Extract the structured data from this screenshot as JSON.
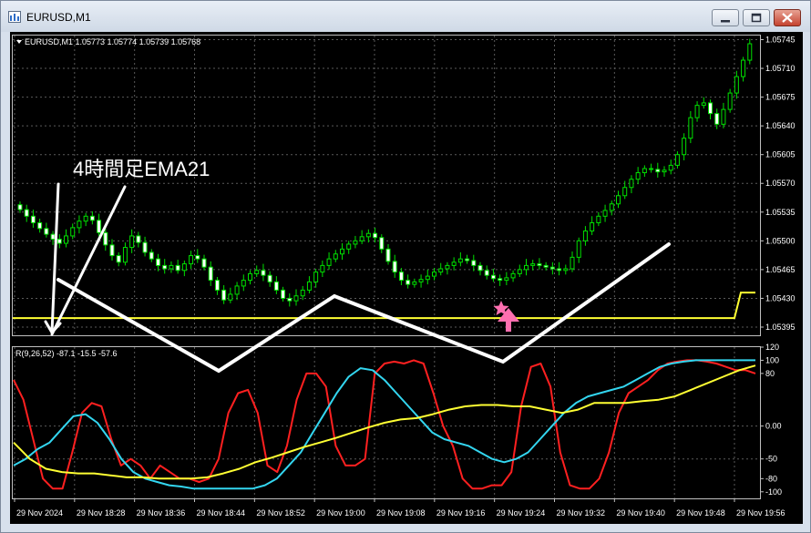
{
  "window": {
    "title": "EURUSD,M1",
    "buttons": [
      "minimize",
      "restore",
      "close"
    ]
  },
  "chart_data": [
    {
      "type": "candlestick",
      "header": "EURUSD,M1  1.05773 1.05774 1.05739 1.05768",
      "annotation": "4時間足EMA21",
      "y_ticks": [
        "1.05745",
        "1.05710",
        "1.05675",
        "1.05640",
        "1.05605",
        "1.05570",
        "1.05535",
        "1.05500",
        "1.05465",
        "1.05430",
        "1.05395"
      ],
      "ylim": [
        1.05385,
        1.0575
      ],
      "x_ticks": [
        "29 Nov 2024",
        "29 Nov 18:28",
        "29 Nov 18:36",
        "29 Nov 18:44",
        "29 Nov 18:52",
        "29 Nov 19:00",
        "29 Nov 19:08",
        "29 Nov 19:16",
        "29 Nov 19:24",
        "29 Nov 19:32",
        "29 Nov 19:40",
        "29 Nov 19:48",
        "29 Nov 19:56"
      ],
      "ema_level": {
        "price": 1.05406,
        "jump_to": 1.05437,
        "color": "#ffff33"
      },
      "signal_icons": [
        "pink-star",
        "pink-up-arrow"
      ],
      "close_values": [
        1.05538,
        1.0553,
        1.05522,
        1.05515,
        1.05508,
        1.05502,
        1.05497,
        1.05506,
        1.05516,
        1.05524,
        1.0553,
        1.05525,
        1.0551,
        1.05495,
        1.05482,
        1.05474,
        1.05492,
        1.05506,
        1.05498,
        1.05486,
        1.05478,
        1.0547,
        1.05466,
        1.0547,
        1.05464,
        1.05472,
        1.05482,
        1.05478,
        1.05468,
        1.05452,
        1.0544,
        1.05428,
        1.05435,
        1.05445,
        1.05452,
        1.0546,
        1.05464,
        1.05458,
        1.0545,
        1.0544,
        1.0543,
        1.05427,
        1.05433,
        1.0544,
        1.0545,
        1.05462,
        1.0547,
        1.05478,
        1.05484,
        1.0549,
        1.05496,
        1.055,
        1.05505,
        1.05509,
        1.05504,
        1.0549,
        1.05475,
        1.05462,
        1.05452,
        1.05447,
        1.0545,
        1.05453,
        1.05457,
        1.05462,
        1.05466,
        1.0547,
        1.05474,
        1.05478,
        1.05476,
        1.0547,
        1.05464,
        1.05458,
        1.05454,
        1.05452,
        1.05455,
        1.0546,
        1.05465,
        1.0547,
        1.05472,
        1.0547,
        1.05468,
        1.05466,
        1.05464,
        1.05466,
        1.0548,
        1.055,
        1.05512,
        1.05522,
        1.0553,
        1.05537,
        1.05545,
        1.05555,
        1.05565,
        1.05575,
        1.05583,
        1.05588,
        1.05587,
        1.05584,
        1.05586,
        1.05592,
        1.05605,
        1.05625,
        1.0565,
        1.05665,
        1.05668,
        1.05655,
        1.05642,
        1.0566,
        1.0568,
        1.057,
        1.0572,
        1.0574
      ]
    },
    {
      "type": "line",
      "header": "R(9,26,52) -87.1 -15.5 -57.6",
      "y_ticks": [
        "120",
        "100",
        "80",
        "0.00",
        "-50",
        "-80",
        "-100"
      ],
      "ylim": [
        -110,
        120
      ],
      "series": [
        {
          "color": "#ff2020",
          "values": [
            70,
            40,
            -20,
            -80,
            -95,
            -95,
            -40,
            20,
            35,
            30,
            -20,
            -60,
            -50,
            -60,
            -80,
            -60,
            -70,
            -80,
            -80,
            -85,
            -80,
            -50,
            20,
            50,
            55,
            20,
            -60,
            -70,
            -30,
            40,
            80,
            80,
            60,
            -30,
            -60,
            -60,
            -50,
            80,
            95,
            98,
            95,
            100,
            95,
            50,
            0,
            -30,
            -80,
            -95,
            -95,
            -90,
            -90,
            -70,
            30,
            90,
            95,
            60,
            -40,
            -90,
            -95,
            -95,
            -80,
            -40,
            20,
            50,
            60,
            70,
            85,
            95,
            98,
            100,
            100,
            98,
            95,
            90,
            85,
            85,
            80
          ]
        },
        {
          "color": "#33d6f0",
          "values": [
            -60,
            -50,
            -35,
            -25,
            -5,
            15,
            18,
            5,
            -20,
            -50,
            -70,
            -80,
            -85,
            -90,
            -92,
            -95,
            -95,
            -95,
            -95,
            -95,
            -95,
            -90,
            -80,
            -60,
            -40,
            -10,
            20,
            50,
            75,
            88,
            85,
            70,
            50,
            30,
            10,
            -10,
            -20,
            -25,
            -30,
            -40,
            -50,
            -55,
            -50,
            -40,
            -20,
            0,
            20,
            35,
            45,
            50,
            55,
            60,
            70,
            80,
            90,
            95,
            98,
            100,
            100,
            100,
            100,
            100,
            100
          ]
        },
        {
          "color": "#ffff33",
          "values": [
            -25,
            -50,
            -65,
            -70,
            -72,
            -72,
            -75,
            -78,
            -78,
            -80,
            -80,
            -80,
            -78,
            -72,
            -65,
            -55,
            -48,
            -40,
            -32,
            -25,
            -18,
            -10,
            -2,
            5,
            10,
            12,
            18,
            25,
            30,
            32,
            32,
            30,
            30,
            25,
            20,
            25,
            35,
            35,
            35,
            38,
            40,
            45,
            55,
            65,
            75,
            85,
            92
          ]
        }
      ]
    }
  ]
}
